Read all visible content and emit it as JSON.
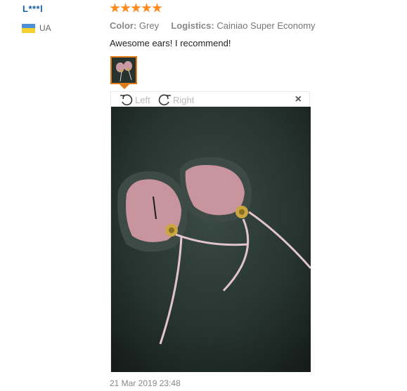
{
  "reviewer": {
    "name": "L***l",
    "country": "UA"
  },
  "rating": {
    "stars": 5,
    "max": 5
  },
  "attributes": {
    "color_label": "Color:",
    "color_value": "Grey",
    "logistics_label": "Logistics:",
    "logistics_value": "Cainiao Super Economy"
  },
  "review": {
    "text": "Awesome ears! I recommend!"
  },
  "viewer": {
    "rotate_left_label": "Left",
    "rotate_right_label": "Right",
    "close_label": "×"
  },
  "date": "21 Mar 2019 23:48",
  "colors": {
    "link": "#1b5fa8",
    "star": "#ff8a1e",
    "accent": "#e07a1a"
  }
}
